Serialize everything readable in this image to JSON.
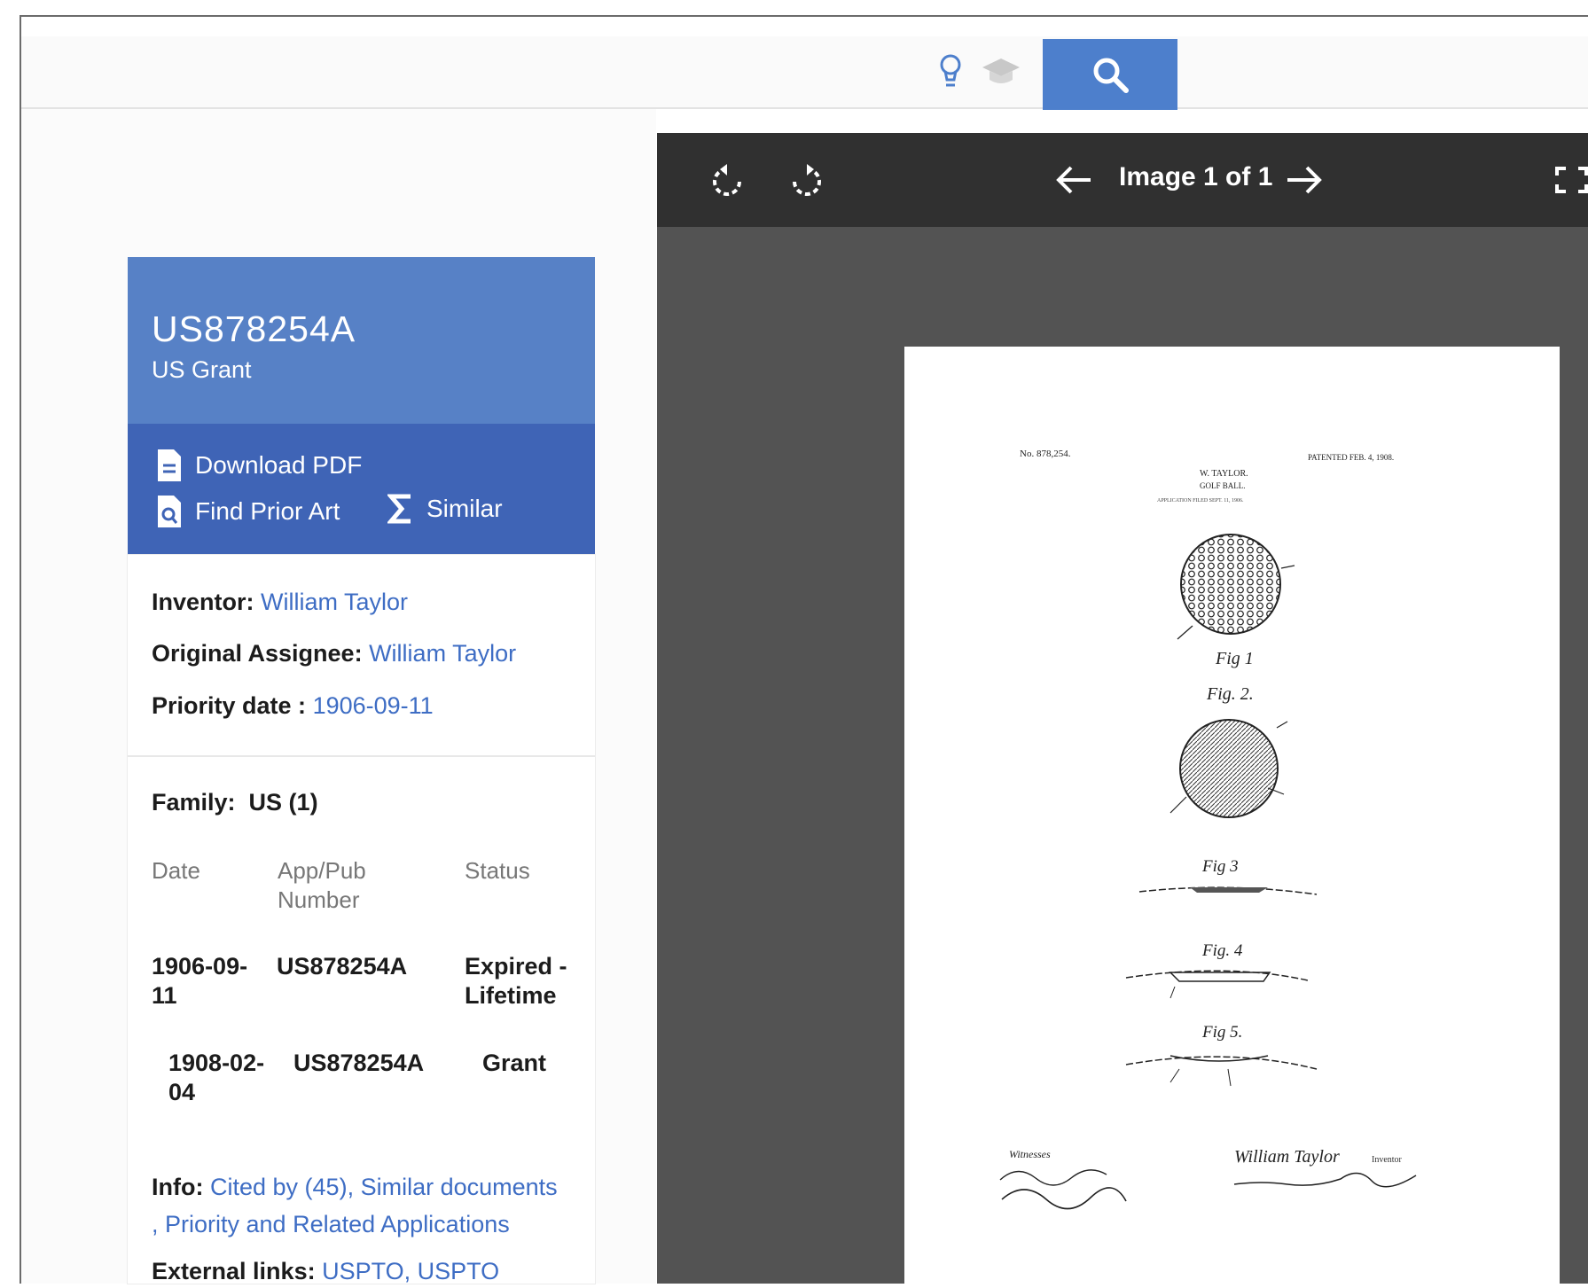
{
  "search": {
    "bulb_icon": "lightbulb-icon",
    "scholar_icon": "mortarboard-icon",
    "search_icon": "magnifier-icon"
  },
  "patent": {
    "number": "US878254A",
    "type": "US Grant",
    "actions": {
      "download_pdf": "Download PDF",
      "find_prior_art": "Find Prior Art",
      "similar": "Similar"
    },
    "inventor_label": "Inventor:",
    "inventor": "William Taylor",
    "assignee_label": "Original Assignee:",
    "assignee": "William Taylor",
    "priority_label": "Priority date :",
    "priority_date": "1906-09-11",
    "family_label": "Family:",
    "family_value": "US (1)",
    "table_headers": {
      "date": "Date",
      "app_pub_1": "App/Pub",
      "app_pub_2": "Number",
      "status": "Status"
    },
    "rows": [
      {
        "date_1": "1906-09-",
        "date_2": "11",
        "number": "US878254A",
        "status_1": "Expired -",
        "status_2": "Lifetime"
      },
      {
        "date_1": "1908-02-",
        "date_2": "04",
        "number": "US878254A",
        "status_1": "Grant",
        "status_2": ""
      }
    ],
    "info_label": "Info:",
    "info_cited": "Cited by (45)",
    "info_similar": "Similar documents",
    "info_priority": "Priority and Related Applications",
    "external_label": "External links:",
    "external_1": "USPTO",
    "external_2": "USPTO"
  },
  "viewer": {
    "counter": "Image 1 of 1",
    "drawing": {
      "left_header": "No. 878,254.",
      "right_header": "PATENTED FEB. 4, 1908.",
      "inventor": "W. TAYLOR.",
      "title": "GOLF BALL.",
      "filed": "APPLICATION FILED SEPT. 11, 1906.",
      "fig1": "Fig 1",
      "fig2": "Fig. 2.",
      "fig3": "Fig 3",
      "fig4": "Fig. 4",
      "fig5": "Fig 5.",
      "witnesses": "Witnesses",
      "inventor_sig": "William Taylor",
      "inventor_role": "Inventor"
    }
  },
  "colors": {
    "accent": "#4d7fcc",
    "card_header": "#5781c6",
    "card_actions": "#3f64b6",
    "link": "#3e6dc4",
    "viewer_bg": "#535353",
    "viewer_bar": "#303030"
  }
}
